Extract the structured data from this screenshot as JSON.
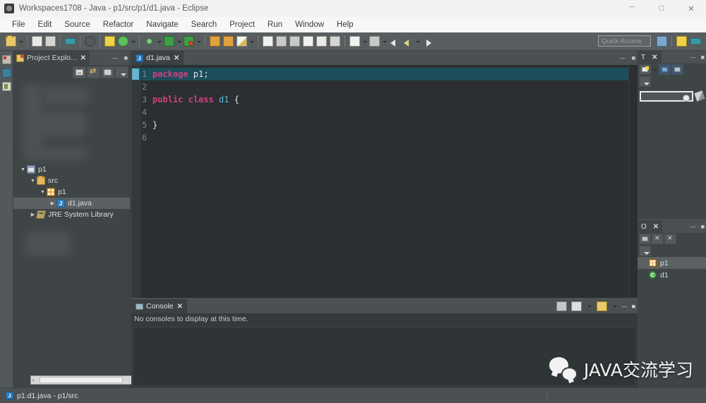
{
  "window": {
    "title": "Workspaces1708 - Java - p1/src/p1/d1.java - Eclipse",
    "minimize_label": "Minimize",
    "maximize_label": "Maximize",
    "close_label": "Close"
  },
  "menubar": {
    "items": [
      {
        "label": "File"
      },
      {
        "label": "Edit"
      },
      {
        "label": "Source"
      },
      {
        "label": "Refactor"
      },
      {
        "label": "Navigate"
      },
      {
        "label": "Search"
      },
      {
        "label": "Project"
      },
      {
        "label": "Run"
      },
      {
        "label": "Window"
      },
      {
        "label": "Help"
      }
    ]
  },
  "toolbar": {
    "quick_access_placeholder": "Quick Access",
    "icons": [
      "new-wizard-icon",
      "save-icon",
      "save-all-icon",
      "print-icon",
      "new-java-project-icon",
      "new-package-icon",
      "refresh-icon",
      "debug-icon",
      "run-icon",
      "coverage-icon",
      "open-type-icon",
      "open-task-icon",
      "new-annotation-icon",
      "search-icon",
      "next-annotation-icon",
      "previous-annotation-icon",
      "toggle-mark-occurrences-icon",
      "skip-breakpoints-icon",
      "back-icon",
      "forward-icon"
    ],
    "perspective_icons": [
      "open-perspective-icon",
      "java-perspective-icon",
      "java-ee-perspective-icon"
    ]
  },
  "explorer": {
    "tab_label": "Project Explo...",
    "tab_close": "✕",
    "toolbar_icons": [
      "collapse-all-icon",
      "link-with-editor-icon",
      "view-menu-icon",
      "chevron-down-icon"
    ],
    "tree": [
      {
        "label": "p1",
        "indent": 0,
        "twisty": "open",
        "icon": "java-project-icon",
        "selected": false
      },
      {
        "label": "src",
        "indent": 1,
        "twisty": "open",
        "icon": "source-folder-icon",
        "selected": false
      },
      {
        "label": "p1",
        "indent": 2,
        "twisty": "open",
        "icon": "package-icon",
        "selected": false
      },
      {
        "label": "d1.java",
        "indent": 3,
        "twisty": "closed",
        "icon": "java-file-icon",
        "selected": true
      },
      {
        "label": "JRE System Library",
        "indent": 1,
        "twisty": "closed",
        "icon": "jre-library-icon",
        "selected": false
      }
    ],
    "hscroll_left": "‹",
    "hscroll_right": "›"
  },
  "editor": {
    "tab_label": "d1.java",
    "tab_close": "✕",
    "file_icon_letter": "J",
    "lines": [
      {
        "num": "1",
        "tokens": [
          {
            "t": "package",
            "c": "kw"
          },
          {
            "t": " p1;",
            "c": "plain"
          }
        ],
        "highlighted": true
      },
      {
        "num": "2",
        "tokens": [],
        "highlighted": false
      },
      {
        "num": "3",
        "tokens": [
          {
            "t": "public",
            "c": "kw"
          },
          {
            "t": " ",
            "c": "plain"
          },
          {
            "t": "class",
            "c": "kw"
          },
          {
            "t": " ",
            "c": "plain"
          },
          {
            "t": "d1",
            "c": "cls"
          },
          {
            "t": " {",
            "c": "plain"
          }
        ],
        "highlighted": false
      },
      {
        "num": "4",
        "tokens": [],
        "highlighted": false
      },
      {
        "num": "5",
        "tokens": [
          {
            "t": "}",
            "c": "plain"
          }
        ],
        "highlighted": false
      },
      {
        "num": "6",
        "tokens": [],
        "highlighted": false
      }
    ],
    "highlight_color": "#1d4c5a",
    "background_color": "#2b2f31",
    "keyword_color": "#d1407f",
    "class_color": "#59b7e0"
  },
  "console": {
    "tab_label": "Console",
    "tab_close": "✕",
    "message": "No consoles to display at this time.",
    "toolbar_icons": [
      "clear-console-icon",
      "display-selected-console-icon",
      "open-console-icon"
    ]
  },
  "tasklist": {
    "tab_label": "T",
    "tab_close": "✕",
    "toolbar_icons": [
      "new-task-icon",
      "chevron-down-icon",
      "synchronize-icon",
      "filter-icon",
      "view-menu-icon"
    ],
    "search_placeholder": ""
  },
  "outline": {
    "tab_label": "O",
    "tab_close": "✕",
    "toolbar_icons": [
      "collapse-all-icon",
      "hide-fields-icon",
      "hide-static-icon",
      "view-menu-icon"
    ],
    "nodes": [
      {
        "label": "p1",
        "icon": "package-icon",
        "selected": true
      },
      {
        "label": "d1",
        "icon": "class-icon",
        "selected": false
      }
    ]
  },
  "statusbar": {
    "text": "p1.d1.java - p1/src",
    "icon_letter": "J",
    "grip": "⋮"
  },
  "watermark": {
    "text": "JAVA交流学习",
    "logo": "wechat-logo-icon"
  }
}
